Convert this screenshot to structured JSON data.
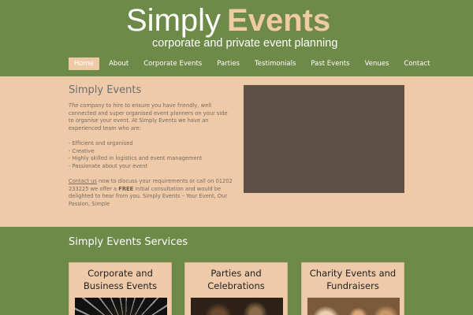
{
  "header": {
    "title_part1": "Simply",
    "title_part2": "Events",
    "tagline": "corporate and private event planning"
  },
  "nav": {
    "items": [
      {
        "label": "Home",
        "active": true
      },
      {
        "label": "About"
      },
      {
        "label": "Corporate Events"
      },
      {
        "label": "Parties"
      },
      {
        "label": "Testimonials"
      },
      {
        "label": "Past Events"
      },
      {
        "label": "Venues"
      },
      {
        "label": "Contact"
      }
    ]
  },
  "hero": {
    "title": "Simply Events",
    "intro_em": "The",
    "intro_rest": " company to hire to ensure you have friendly, well connected and  super organised event planners on your side to organise your event. At Simply Events we have an experienced team who are:",
    "bullets": [
      "- Efficient and organised",
      "- Creative",
      "- Highly skilled in logistics and event management",
      "- Passionate about your event"
    ],
    "contact_link": "Contact us",
    "contact_text": " now to discuss your requirements or call on 01202 233225 we offer a ",
    "free": "FREE",
    "contact_text2": " initial consultation and would be delighted to hear from you. Simply Events – Your Event, Our Passion, Simple"
  },
  "services": {
    "title": "Simply Events Services",
    "cards": [
      {
        "title": "Corporate and Business Events"
      },
      {
        "title": "Parties and Celebrations"
      },
      {
        "title": "Charity Events and Fundraisers"
      }
    ]
  },
  "colors": {
    "green": "#6e8a48",
    "peach": "#efcaa8",
    "accent": "#efcaa2",
    "video": "#5d5047"
  }
}
